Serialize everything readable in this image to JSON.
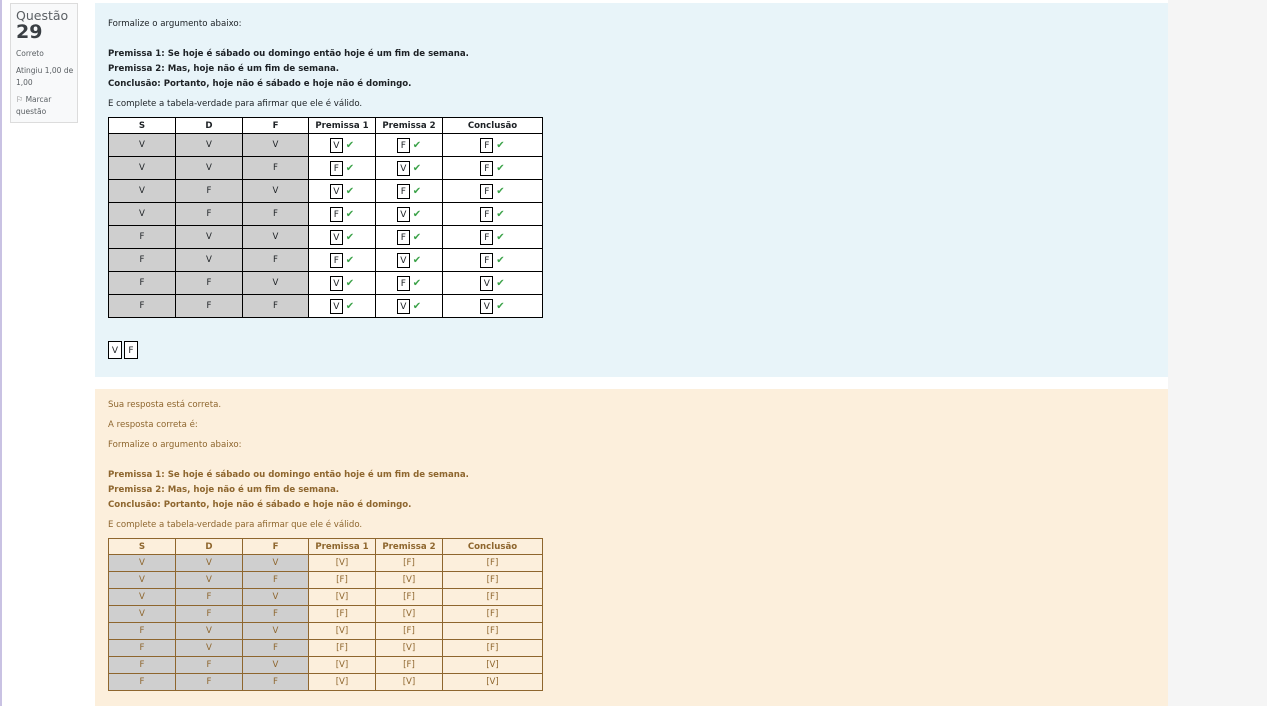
{
  "info": {
    "label": "Questão",
    "number": "29",
    "state": "Correto",
    "grade": "Atingiu 1,00 de 1,00",
    "flag_label": "Marcar questão"
  },
  "question": {
    "intro": "Formalize o argumento abaixo:",
    "premise1": "Premissa 1: Se hoje é sábado ou domingo então hoje é um fim de semana.",
    "premise2": "Premissa 2: Mas, hoje não é um fim de semana.",
    "conclusion": "Conclusão: Portanto, hoje não é sábado e hoje não é domingo.",
    "instruction": "E complete a tabela-verdade para afirmar que ele é válido.",
    "headers": [
      "S",
      "D",
      "F",
      "Premissa 1",
      "Premissa 2",
      "Conclusão"
    ],
    "rows": [
      {
        "s": "V",
        "d": "V",
        "f": "V",
        "p1": "V",
        "p2": "F",
        "c": "F"
      },
      {
        "s": "V",
        "d": "V",
        "f": "F",
        "p1": "F",
        "p2": "V",
        "c": "F"
      },
      {
        "s": "V",
        "d": "F",
        "f": "V",
        "p1": "V",
        "p2": "F",
        "c": "F"
      },
      {
        "s": "V",
        "d": "F",
        "f": "F",
        "p1": "F",
        "p2": "V",
        "c": "F"
      },
      {
        "s": "F",
        "d": "V",
        "f": "V",
        "p1": "V",
        "p2": "F",
        "c": "F"
      },
      {
        "s": "F",
        "d": "V",
        "f": "F",
        "p1": "F",
        "p2": "V",
        "c": "F"
      },
      {
        "s": "F",
        "d": "F",
        "f": "V",
        "p1": "V",
        "p2": "F",
        "c": "V"
      },
      {
        "s": "F",
        "d": "F",
        "f": "F",
        "p1": "V",
        "p2": "V",
        "c": "V"
      }
    ],
    "drag_items": [
      "V",
      "F"
    ]
  },
  "feedback": {
    "result": "Sua resposta está correta.",
    "correct_label": "A resposta correta é:",
    "intro": "Formalize o argumento abaixo:",
    "premise1": "Premissa 1: Se hoje é sábado ou domingo então hoje é um fim de semana.",
    "premise2": "Premissa 2: Mas, hoje não é um fim de semana.",
    "conclusion": "Conclusão: Portanto, hoje não é sábado e hoje não é domingo.",
    "instruction": "E complete a tabela-verdade para afirmar que ele é válido.",
    "headers": [
      "S",
      "D",
      "F",
      "Premissa 1",
      "Premissa 2",
      "Conclusão"
    ],
    "rows": [
      {
        "s": "V",
        "d": "V",
        "f": "V",
        "p1": "[V]",
        "p2": "[F]",
        "c": "[F]"
      },
      {
        "s": "V",
        "d": "V",
        "f": "F",
        "p1": "[F]",
        "p2": "[V]",
        "c": "[F]"
      },
      {
        "s": "V",
        "d": "F",
        "f": "V",
        "p1": "[V]",
        "p2": "[F]",
        "c": "[F]"
      },
      {
        "s": "V",
        "d": "F",
        "f": "F",
        "p1": "[F]",
        "p2": "[V]",
        "c": "[F]"
      },
      {
        "s": "F",
        "d": "V",
        "f": "V",
        "p1": "[V]",
        "p2": "[F]",
        "c": "[F]"
      },
      {
        "s": "F",
        "d": "V",
        "f": "F",
        "p1": "[F]",
        "p2": "[V]",
        "c": "[F]"
      },
      {
        "s": "F",
        "d": "F",
        "f": "V",
        "p1": "[V]",
        "p2": "[F]",
        "c": "[V]"
      },
      {
        "s": "F",
        "d": "F",
        "f": "F",
        "p1": "[V]",
        "p2": "[V]",
        "c": "[V]"
      }
    ]
  },
  "colors": {
    "question_bg": "#e8f4f9",
    "feedback_bg": "#fcefdc",
    "feedback_text": "#8e662e",
    "check": "#3da34a",
    "given_cell": "#cfcfcf"
  },
  "icons": {
    "flag": "flag-icon",
    "correct": "check-icon"
  }
}
